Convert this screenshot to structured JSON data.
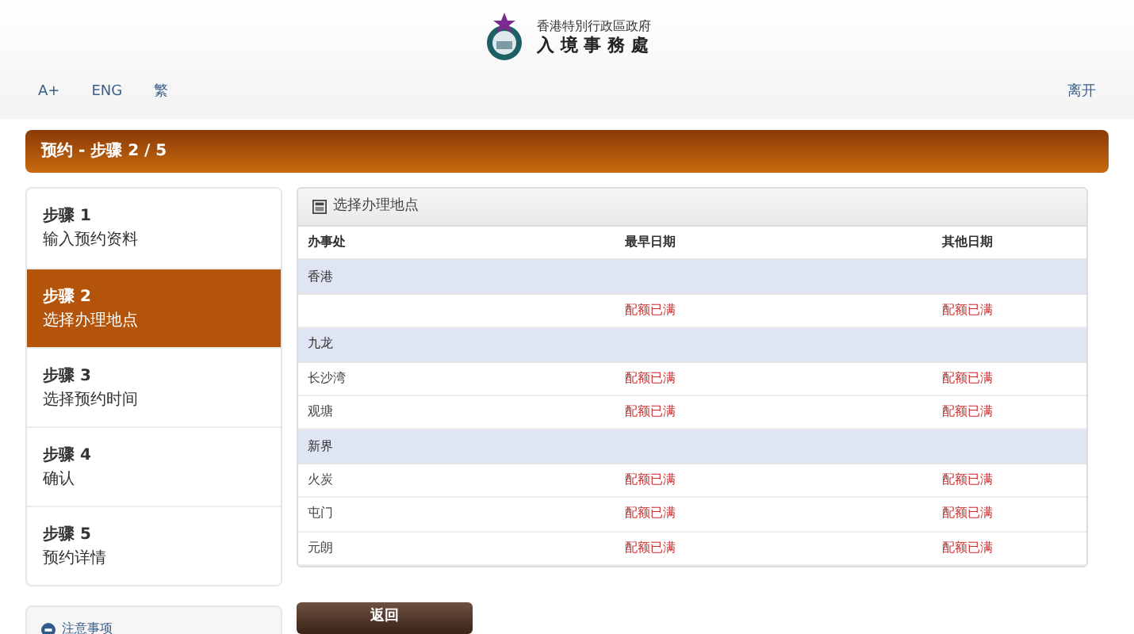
{
  "header": {
    "department_lines": [
      "香港特別行政區政府",
      "入 境 事 務 處"
    ]
  },
  "nav": {
    "left": [
      "A+",
      "ENG",
      "繁"
    ],
    "right": [
      "离开"
    ]
  },
  "progress_bar": {
    "title": "预约 - 步骤 2 / 5"
  },
  "steps": [
    {
      "step": "步骤 1",
      "label": "输入预约资料",
      "selected": false
    },
    {
      "step": "步骤 2",
      "label": "选择办理地点",
      "selected": true
    },
    {
      "step": "步骤 3",
      "label": "选择预约时间",
      "selected": false
    },
    {
      "step": "步骤 4",
      "label": "确认",
      "selected": false
    },
    {
      "step": "步骤 5",
      "label": "预约详情",
      "selected": false
    }
  ],
  "notes": {
    "title": "注意事项"
  },
  "panel": {
    "title": "选择办理地点",
    "columns": [
      "办事处",
      "最早日期",
      "其他日期"
    ],
    "rows": [
      {
        "kind": "group",
        "office": "香港"
      },
      {
        "kind": "office",
        "earliest": "配额已满",
        "other": "配额已满"
      },
      {
        "kind": "group",
        "office": "九龙"
      },
      {
        "kind": "office",
        "office": "长沙湾",
        "earliest": "配额已满",
        "other": "配额已满"
      },
      {
        "kind": "office",
        "office": "观塘",
        "earliest": "配额已满",
        "other": "配额已满"
      },
      {
        "kind": "group",
        "office": "新界"
      },
      {
        "kind": "office",
        "office": "火炭",
        "earliest": "配额已满",
        "other": "配额已满"
      },
      {
        "kind": "office",
        "office": "屯门",
        "earliest": "配额已满",
        "other": "配额已满"
      },
      {
        "kind": "office",
        "office": "元朗",
        "earliest": "配额已满",
        "other": "配额已满"
      }
    ]
  },
  "back_button": "返回"
}
